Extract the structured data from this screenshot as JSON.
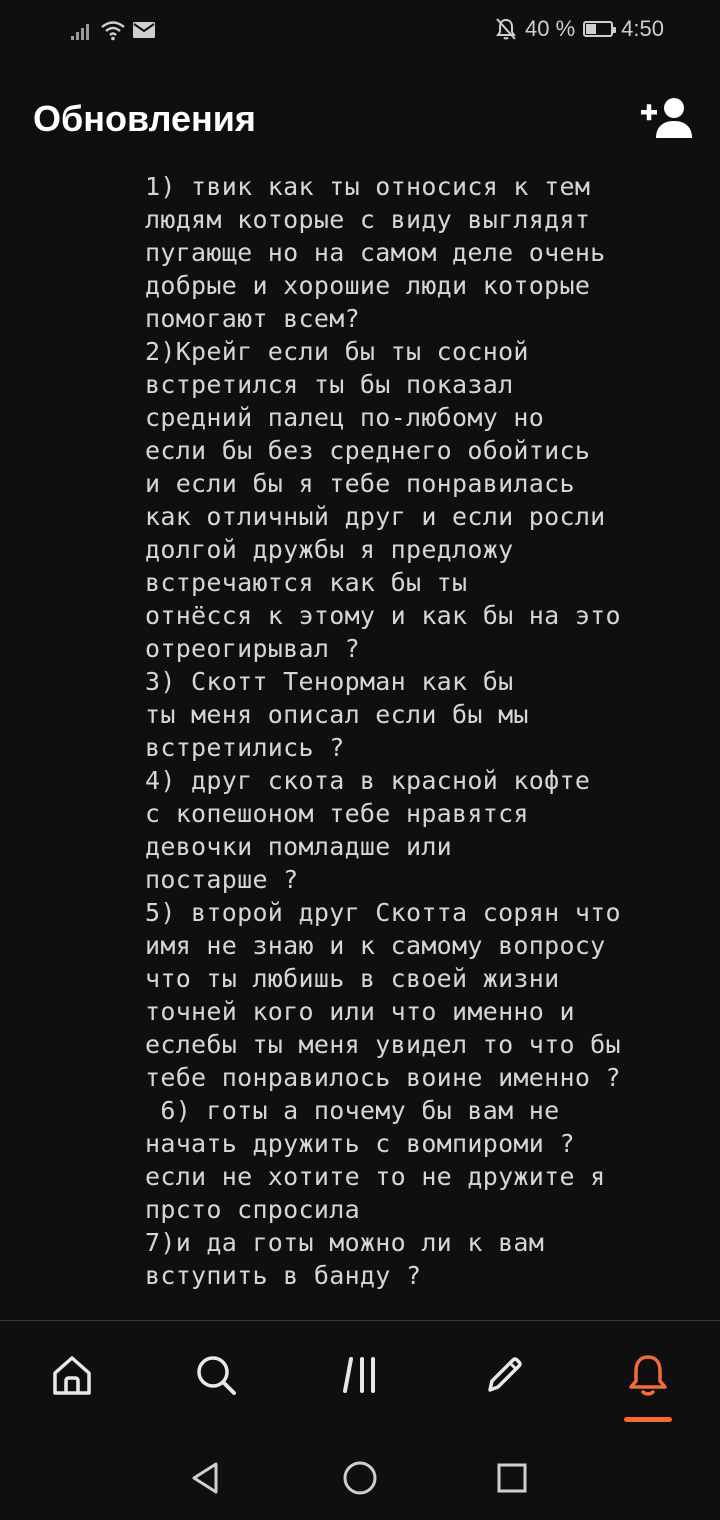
{
  "status_bar": {
    "battery_percent": "40 %",
    "time": "4:50",
    "battery_level": 0.4
  },
  "header": {
    "title": "Обновления"
  },
  "post": {
    "text": "1) твик как ты относися к тем\nлюдям которые с виду выглядят\nпугающе но на самом деле очень\nдобрые и хорошие люди которые\nпомогают всем?\n2)Крейг если бы ты сосной\nвстретился ты бы показал\nсредний палец по-любому но\nесли бы без среднего обойтись\nи если бы я тебе понравилась\nкак отличный друг и если росли\nдолгой дружбы я предложу\nвстречаются как бы ты\nотнёсся к этому и как бы на это\nотреогирывал ?\n3) Скотт Тенорман как бы\nты меня описал если бы мы\nвстретились ?\n4) друг скота в красной кофте\nс копешоном тебе нравятся\nдевочки помладше или\nпостарше ?\n5) второй друг Скотта сорян что\nимя не знаю и к самому вопросу\nчто ты любишь в своей жизни\nточней кого или что именно и\nеслебы ты меня увидел то что бы\nтебе понравилось воине именно ?\n 6) готы а почему бы вам не\nначать дружить с вомпироми ?\nесли не хотите то не дружите я\nпрсто спросила\n7)и да готы можно ли к вам\nвступить в банду ?"
  },
  "bottom_nav": {
    "items": [
      {
        "icon": "home-icon"
      },
      {
        "icon": "search-icon"
      },
      {
        "icon": "feed-icon"
      },
      {
        "icon": "pencil-icon"
      },
      {
        "icon": "bell-icon",
        "active": true
      }
    ],
    "accent_color": "#f26b3a",
    "icon_color": "#e8e8e8"
  },
  "system_nav": {
    "items": [
      {
        "icon": "back-triangle-icon"
      },
      {
        "icon": "home-circle-icon"
      },
      {
        "icon": "recents-square-icon"
      }
    ]
  }
}
